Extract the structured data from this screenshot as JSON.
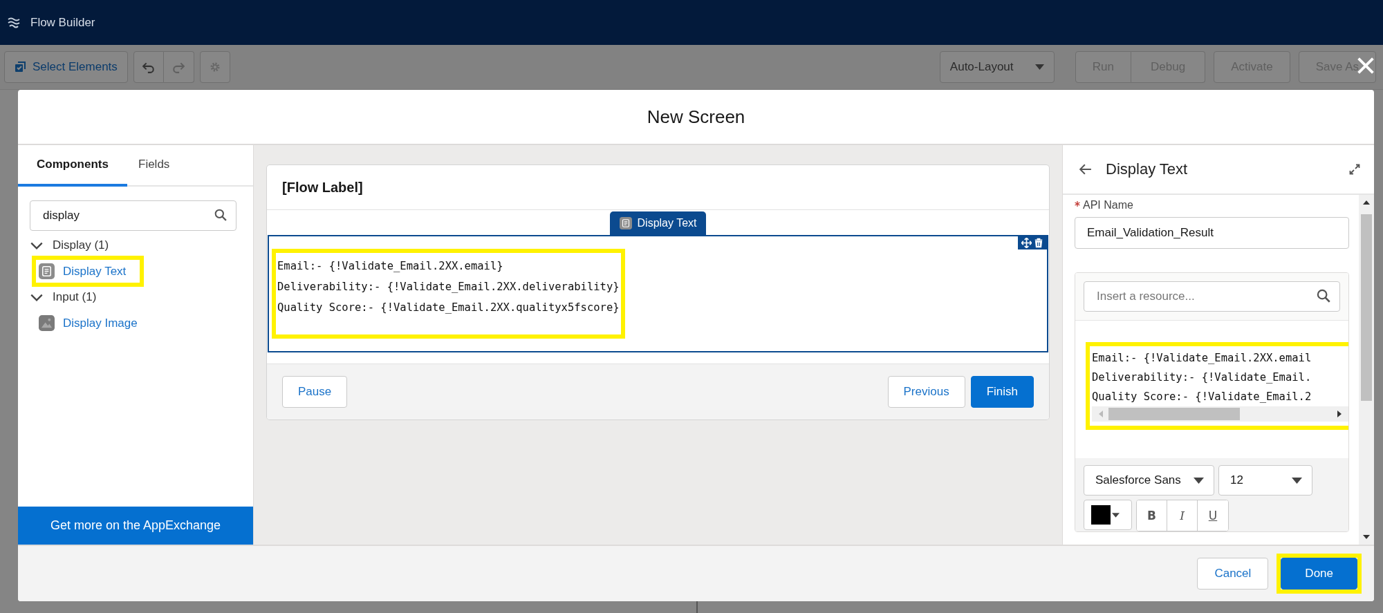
{
  "app_bar": {
    "title": "Flow Builder"
  },
  "toolbar": {
    "select_button": "Select Elements",
    "redo_disabled": true,
    "layout_dropdown": "Auto-Layout",
    "actions": [
      {
        "label": "Run",
        "disabled": true
      },
      {
        "label": "Debug",
        "disabled": true
      },
      {
        "label": "Activate",
        "disabled": true
      },
      {
        "label": "Save As",
        "disabled": true
      }
    ]
  },
  "modal": {
    "title": "New Screen",
    "left_panel": {
      "tabs": [
        {
          "label": "Components",
          "selected": true
        },
        {
          "label": "Fields",
          "selected": false
        }
      ],
      "search": {
        "value": "display"
      },
      "groups": [
        {
          "label": "Display (1)",
          "expanded": true,
          "children": [
            {
              "label": "Display Text",
              "kind": "text",
              "highlighted": true
            }
          ]
        },
        {
          "label": "Input (1)",
          "expanded": true,
          "children": [
            {
              "label": "Display Image",
              "kind": "image",
              "highlighted": false
            }
          ]
        }
      ],
      "footer_link": "Get more on the AppExchange"
    },
    "canvas": {
      "card_title": "[Flow Label]",
      "component_tab": "Display Text",
      "highlighted": true,
      "lines": [
        "Email:- {!Validate_Email.2XX.email}",
        "Deliverability:- {!Validate_Email.2XX.deliverability}",
        "Quality Score:- {!Validate_Email.2XX.qualityx5fscore}"
      ],
      "buttons": [
        {
          "label": "Pause",
          "kind": "neutral"
        },
        {
          "label": "Previous",
          "kind": "neutral"
        },
        {
          "label": "Finish",
          "kind": "brand"
        }
      ]
    },
    "properties": {
      "title": "Display Text",
      "api_name_label": "API Name",
      "required": true,
      "api_name_value": "Email_Validation_Result",
      "resource_placeholder": "Insert a resource...",
      "highlighted": true,
      "lines": [
        "Email:- {!Validate_Email.2XX.email",
        "Deliverability:- {!Validate_Email.",
        "Quality Score:- {!Validate_Email.2"
      ],
      "font_family": "Salesforce Sans",
      "font_size": "12",
      "format_buttons": [
        {
          "label": "B",
          "kind": "bold"
        },
        {
          "label": "I",
          "kind": "italic"
        },
        {
          "label": "U",
          "kind": "underline"
        }
      ]
    },
    "footer_buttons": [
      {
        "label": "Cancel",
        "kind": "neutral",
        "highlighted": false
      },
      {
        "label": "Done",
        "kind": "brand",
        "highlighted": true
      }
    ]
  }
}
